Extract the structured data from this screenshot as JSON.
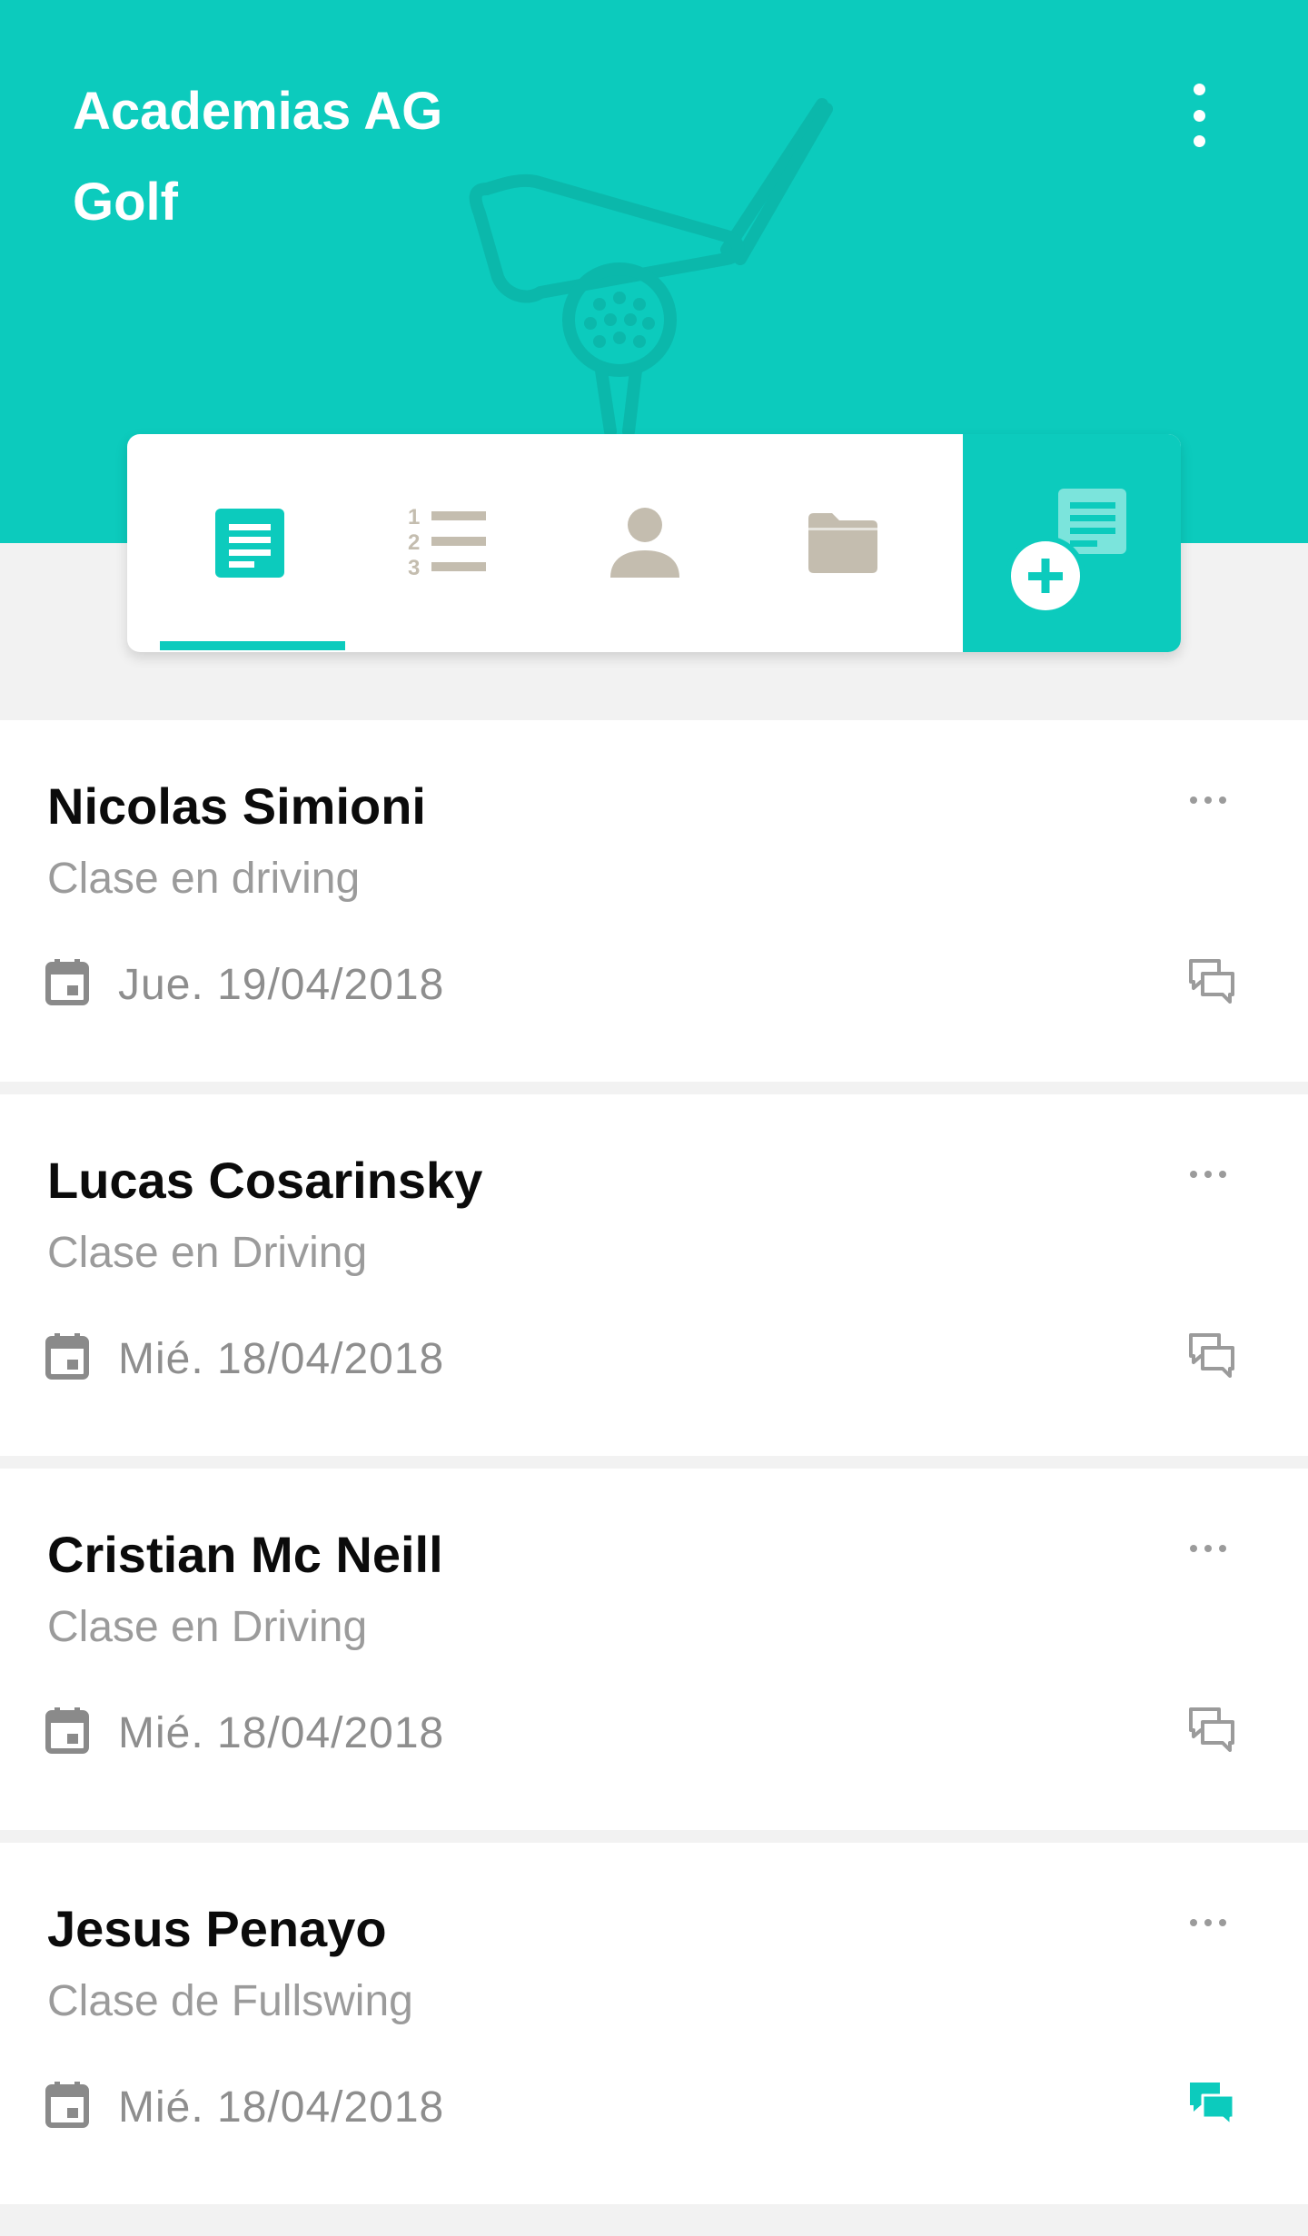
{
  "header": {
    "title_line1": "Academias AG",
    "title_line2": "Golf",
    "background_color": "#0ccbbd",
    "menu_icon": "more-vert-icon",
    "watermark_icon": "golf-club-ball-icon"
  },
  "tabs": [
    {
      "id": "notes",
      "icon": "notes-icon",
      "active": true
    },
    {
      "id": "list",
      "icon": "numbered-list-icon",
      "active": false
    },
    {
      "id": "profile",
      "icon": "person-icon",
      "active": false
    },
    {
      "id": "files",
      "icon": "folder-icon",
      "active": false
    }
  ],
  "new_note_button": {
    "icon": "add-note-icon"
  },
  "colors": {
    "accent": "#0ccbbd",
    "tab_inactive": "#c4bdaf",
    "name": "#0b0b0b",
    "secondary_text": "#9b9b9b",
    "icon_gray": "#8a8a8a"
  },
  "cards": [
    {
      "name": "Nicolas Simioni",
      "subtitle": "Clase en driving",
      "date": "Jue. 19/04/2018",
      "has_new_comments": false
    },
    {
      "name": "Lucas Cosarinsky",
      "subtitle": "Clase en Driving",
      "date": "Mié. 18/04/2018",
      "has_new_comments": false
    },
    {
      "name": "Cristian Mc Neill",
      "subtitle": "Clase en Driving",
      "date": "Mié. 18/04/2018",
      "has_new_comments": false
    },
    {
      "name": "Jesus Penayo",
      "subtitle": "Clase de Fullswing",
      "date": "Mié. 18/04/2018",
      "has_new_comments": true
    }
  ]
}
